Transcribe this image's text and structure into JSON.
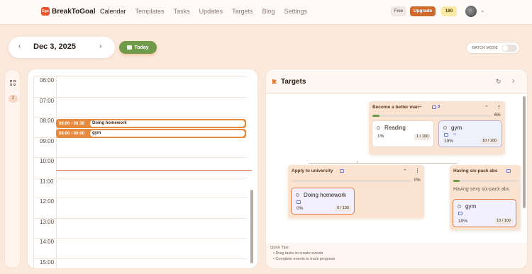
{
  "app": {
    "logo_mark": "Ego",
    "name": "BreakToGoal"
  },
  "nav": [
    {
      "label": "Calendar",
      "active": true
    },
    {
      "label": "Templates"
    },
    {
      "label": "Tasks"
    },
    {
      "label": "Updates"
    },
    {
      "label": "Targets"
    },
    {
      "label": "Blog"
    },
    {
      "label": "Settings"
    }
  ],
  "account": {
    "plan": "Free",
    "upgrade_label": "Upgrade",
    "points": "180"
  },
  "datebar": {
    "date": "Dec 3, 2025",
    "today_label": "Today",
    "batch_label": "BATCH MODE",
    "batch_on": false
  },
  "sidebar": {
    "badge": "2"
  },
  "calendar": {
    "hours": [
      "06:00",
      "07:00",
      "08:00",
      "09:00",
      "10:00",
      "11:00",
      "12:00",
      "13:00",
      "14:00",
      "15:00"
    ],
    "events": [
      {
        "time": "08:00 - 08:30",
        "title": "Doing homework"
      },
      {
        "time": "08:00 - 09:00",
        "title": "gym"
      }
    ]
  },
  "targets": {
    "title": "Targets",
    "cards": [
      {
        "name": "Become a better man~",
        "count": "3",
        "progress": 6,
        "pct_label": "6%",
        "tasks": [
          {
            "name": "Reading",
            "pct": "1%",
            "frac": "1 / 100"
          },
          {
            "name": "gym",
            "pct": "10%",
            "frac": "10 / 100",
            "link": "∞"
          }
        ]
      },
      {
        "name": "Apply to university",
        "progress": 0,
        "pct_label": "0%",
        "tasks": [
          {
            "name": "Doing homework",
            "pct": "0%",
            "frac": "0 / 100"
          }
        ]
      },
      {
        "name": "Having six-pack abs",
        "description": "Having sexy six-pack abs",
        "progress": 10,
        "tasks": [
          {
            "name": "gym",
            "pct": "10%",
            "frac": "10 / 100"
          }
        ]
      }
    ],
    "tips_title": "Quick Tips:",
    "tips": [
      "• Drag tasks to create events",
      "• Complete events to track progress"
    ]
  },
  "colors": {
    "accent": "#d06a2c",
    "event": "#e58a3e",
    "progress": "#6f9a4a",
    "background": "#fbe9dc"
  }
}
